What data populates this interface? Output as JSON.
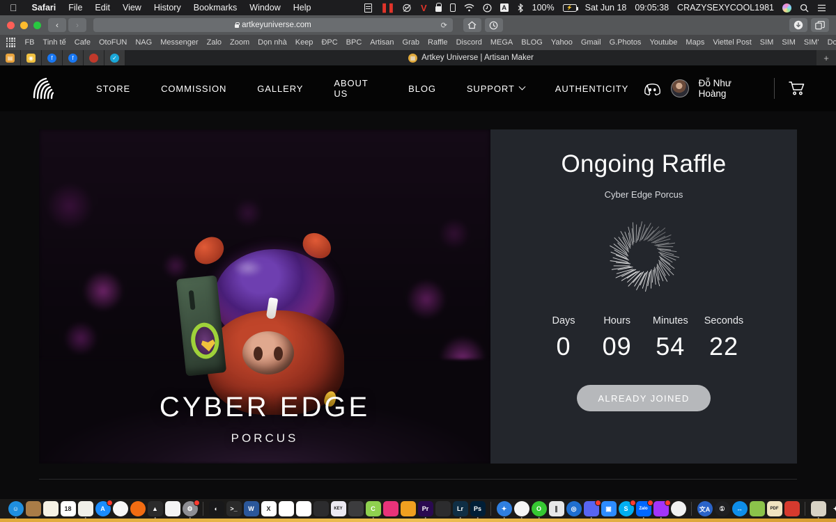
{
  "menubar": {
    "apple": "apple-logo",
    "items": [
      {
        "label": "Safari",
        "bold": true
      },
      {
        "label": "File"
      },
      {
        "label": "Edit"
      },
      {
        "label": "View"
      },
      {
        "label": "History"
      },
      {
        "label": "Bookmarks"
      },
      {
        "label": "Window"
      },
      {
        "label": "Help"
      }
    ],
    "status": {
      "battery_percent": "100%",
      "date": "Sat Jun 18",
      "time": "09:05:38",
      "user": "CRAZYSEXYCOOL1981",
      "input_source": "A",
      "icons": [
        "screen-record-icon",
        "pause-icon",
        "camera-off-icon",
        "v-icon",
        "lock-icon",
        "phone-icon",
        "wifi-icon",
        "time-machine-icon",
        "input-source-icon",
        "bluetooth-icon",
        "battery-icon",
        "globe-icon",
        "search-icon",
        "control-center-icon"
      ]
    }
  },
  "toolbar": {
    "back": "‹",
    "forward": "›",
    "url": "artkeyuniverse.com",
    "reload": "⟳",
    "home": "home-icon",
    "history": "history-icon",
    "downloads": "downloads-icon",
    "tab_overview": "tab-overview-icon"
  },
  "bookmarks": {
    "items": [
      "FB",
      "Tinh tế",
      "Cafe",
      "OtoFUN",
      "NAG",
      "Messenger",
      "Zalo",
      "Zoom",
      "Dọn nhà",
      "Keep",
      "ĐPC",
      "BPC",
      "Artisan",
      "Grab",
      "Raffle",
      "Discord",
      "MEGA",
      "BLOG",
      "Yahoo",
      "Gmail",
      "G.Photos",
      "Youtube",
      "Maps",
      "Viettel Post",
      "SIM",
      "SIM",
      "SIM'",
      "Download"
    ],
    "overflow": "»"
  },
  "tabs": {
    "active_title": "Artkey Universe | Artisan Maker",
    "pinned": [
      "pinned-tab-1",
      "pinned-tab-2",
      "pinned-tab-3",
      "pinned-tab-4",
      "pinned-tab-5",
      "pinned-tab-6"
    ],
    "new_tab": "+"
  },
  "site": {
    "logo": "artkey-fingerprint-logo",
    "nav": [
      {
        "label": "STORE",
        "dropdown": false
      },
      {
        "label": "COMMISSION",
        "dropdown": false
      },
      {
        "label": "GALLERY",
        "dropdown": false
      },
      {
        "label": "ABOUT US",
        "dropdown": false
      },
      {
        "label": "BLOG",
        "dropdown": false
      },
      {
        "label": "SUPPORT",
        "dropdown": true
      },
      {
        "label": "AUTHENTICITY",
        "dropdown": false
      }
    ],
    "account": {
      "discord_icon": "discord-icon",
      "username": "Đỗ Như Hoàng",
      "cart_icon": "cart-icon"
    }
  },
  "hero": {
    "title": "CYBER EDGE",
    "subtitle": "PORCUS",
    "artwork": "cyber-edge-porcus-figure-photo"
  },
  "raffle": {
    "heading": "Ongoing Raffle",
    "prize": "Cyber Edge Porcus",
    "spinner": "radial-burst-loader",
    "countdown": [
      {
        "label": "Days",
        "value": "0"
      },
      {
        "label": "Hours",
        "value": "09"
      },
      {
        "label": "Minutes",
        "value": "54"
      },
      {
        "label": "Seconds",
        "value": "22"
      }
    ],
    "cta": "ALREADY JOINED"
  },
  "colors": {
    "panel_bg": "#23262c",
    "page_bg": "#0b0b0c",
    "cta_bg": "#b6b8bb",
    "accent": "#e0a93b"
  },
  "dock": {
    "items": [
      {
        "name": "finder",
        "glyph": "☺",
        "bg": "#1f8fe0"
      },
      {
        "name": "contacts",
        "glyph": "",
        "bg": "#a97c47"
      },
      {
        "name": "notes",
        "glyph": "",
        "bg": "#f6f2e4"
      },
      {
        "name": "calendar",
        "glyph": "18",
        "bg": "#ffffff"
      },
      {
        "name": "photos",
        "glyph": "",
        "bg": "#f0efe8"
      },
      {
        "name": "app-store",
        "glyph": "A",
        "bg": "#1a8cff"
      },
      {
        "name": "itunes",
        "glyph": "♪",
        "bg": "#f7f7f7"
      },
      {
        "name": "books",
        "glyph": "",
        "bg": "#f26c12"
      },
      {
        "name": "vlc",
        "glyph": "▲",
        "bg": "#2b2b2b"
      },
      {
        "name": "pages",
        "glyph": "",
        "bg": "#f4f4f4"
      },
      {
        "name": "system-preferences",
        "glyph": "⚙",
        "bg": "#8e8e93"
      },
      {
        "name": "separator-1",
        "glyph": "",
        "bg": ""
      },
      {
        "name": "cleaner",
        "glyph": "◐",
        "bg": "#18181a"
      },
      {
        "name": "terminal",
        "glyph": ">_",
        "bg": "#2a2a2a"
      },
      {
        "name": "word",
        "glyph": "W",
        "bg": "#2b579a"
      },
      {
        "name": "excel",
        "glyph": "X",
        "bg": "#ffffff"
      },
      {
        "name": "outlook",
        "glyph": "",
        "bg": "#ffffff"
      },
      {
        "name": "keynote-deck",
        "glyph": "",
        "bg": "#ffffff"
      },
      {
        "name": "colors-app",
        "glyph": "",
        "bg": "#2c2c2e"
      },
      {
        "name": "keynote",
        "glyph": "KEY",
        "bg": "#ece9f2"
      },
      {
        "name": "unarchiver",
        "glyph": "",
        "bg": "#3c3c3e"
      },
      {
        "name": "camtasia",
        "glyph": "C",
        "bg": "#8fd14f"
      },
      {
        "name": "rar",
        "glyph": "",
        "bg": "#e8337a"
      },
      {
        "name": "toolbox",
        "glyph": "",
        "bg": "#f0a020"
      },
      {
        "name": "premiere-pro",
        "glyph": "Pr",
        "bg": "#2a0a50"
      },
      {
        "name": "final-cut",
        "glyph": "",
        "bg": "#2c2c2e"
      },
      {
        "name": "lightroom",
        "glyph": "Lr",
        "bg": "#0f2e44"
      },
      {
        "name": "photoshop",
        "glyph": "Ps",
        "bg": "#001e36"
      },
      {
        "name": "separator-2",
        "glyph": "",
        "bg": ""
      },
      {
        "name": "safari",
        "glyph": "✦",
        "bg": "#2f7fe0"
      },
      {
        "name": "chrome",
        "glyph": "",
        "bg": "#f5f5f5"
      },
      {
        "name": "opera",
        "glyph": "O",
        "bg": "#36c832"
      },
      {
        "name": "parallels",
        "glyph": "∥",
        "bg": "#e8e8e8"
      },
      {
        "name": "obs",
        "glyph": "◎",
        "bg": "#1f6fd0"
      },
      {
        "name": "discord",
        "glyph": "",
        "bg": "#5865f2"
      },
      {
        "name": "zoom-app",
        "glyph": "▣",
        "bg": "#2d8cff"
      },
      {
        "name": "skype",
        "glyph": "S",
        "bg": "#00aff0"
      },
      {
        "name": "zalo",
        "glyph": "Zalo",
        "bg": "#0068ff"
      },
      {
        "name": "messenger",
        "glyph": "",
        "bg": "#a334fa"
      },
      {
        "name": "icloud",
        "glyph": "",
        "bg": "#f2f2f2"
      },
      {
        "name": "separator-3",
        "glyph": "",
        "bg": ""
      },
      {
        "name": "translate",
        "glyph": "文A",
        "bg": "#2a63c8"
      },
      {
        "name": "1password",
        "glyph": "①",
        "bg": "#1f1f21"
      },
      {
        "name": "teamviewer",
        "glyph": "↔",
        "bg": "#0e8ee9"
      },
      {
        "name": "android-file-transfer",
        "glyph": "",
        "bg": "#8bc34a"
      },
      {
        "name": "pdf-tool",
        "glyph": "PDF",
        "bg": "#f0e3c0"
      },
      {
        "name": "mail-box",
        "glyph": "",
        "bg": "#d63a2e"
      },
      {
        "name": "separator-4",
        "glyph": "",
        "bg": ""
      },
      {
        "name": "documents-folder",
        "glyph": "",
        "bg": "#d8d2c4"
      },
      {
        "name": "bluetooth-share",
        "glyph": "✦",
        "bg": "#1b1a19"
      },
      {
        "name": "downloads-folder",
        "glyph": "",
        "bg": "#c8c2b4"
      },
      {
        "name": "windows-folder",
        "glyph": "",
        "bg": "#b8b2a4"
      },
      {
        "name": "archive-folder",
        "glyph": "",
        "bg": "#cfc9bb"
      },
      {
        "name": "shared-folder",
        "glyph": "",
        "bg": "#b0c4de"
      },
      {
        "name": "separator-5",
        "glyph": "",
        "bg": ""
      },
      {
        "name": "trash",
        "glyph": "",
        "bg": "#9a9a9a"
      }
    ]
  }
}
